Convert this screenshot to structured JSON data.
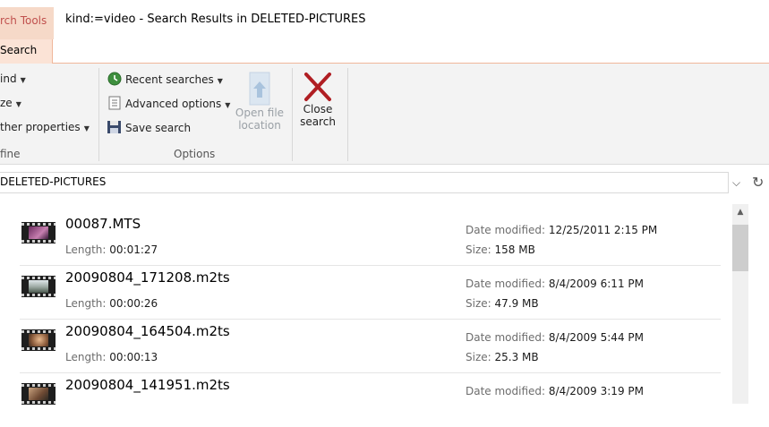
{
  "window": {
    "context_tab": "rch Tools",
    "title": "kind:=video - Search Results in DELETED-PICTURES"
  },
  "tabs": {
    "active": "Search"
  },
  "ribbon": {
    "refine": {
      "kind": "ind",
      "size": "ze",
      "other_properties": "ther properties",
      "label": "fine"
    },
    "options": {
      "recent_searches": "Recent searches",
      "advanced_options": "Advanced options",
      "save_search": "Save search",
      "label": "Options"
    },
    "open_file_location": {
      "line1": "Open file",
      "line2": "location"
    },
    "close_search": {
      "line1": "Close",
      "line2": "search"
    }
  },
  "address": {
    "path": "DELETED-PICTURES"
  },
  "results": {
    "length_label": "Length:",
    "date_label": "Date modified:",
    "size_label": "Size:",
    "items": [
      {
        "name": "00087.MTS",
        "length": "00:01:27",
        "date": "12/25/2011 2:15 PM",
        "size": "158 MB"
      },
      {
        "name": "20090804_171208.m2ts",
        "length": "00:00:26",
        "date": "8/4/2009 6:11 PM",
        "size": "47.9 MB"
      },
      {
        "name": "20090804_164504.m2ts",
        "length": "00:00:13",
        "date": "8/4/2009 5:44 PM",
        "size": "25.3 MB"
      },
      {
        "name": "20090804_141951.m2ts",
        "length": "",
        "date": "8/4/2009 3:19 PM",
        "size": ""
      }
    ]
  },
  "colors": {
    "context_tab_bg": "#f6d9c8",
    "context_tab_text": "#c0504d",
    "close_x": "#b01e23",
    "ribbon_bg": "#f3f3f3"
  }
}
